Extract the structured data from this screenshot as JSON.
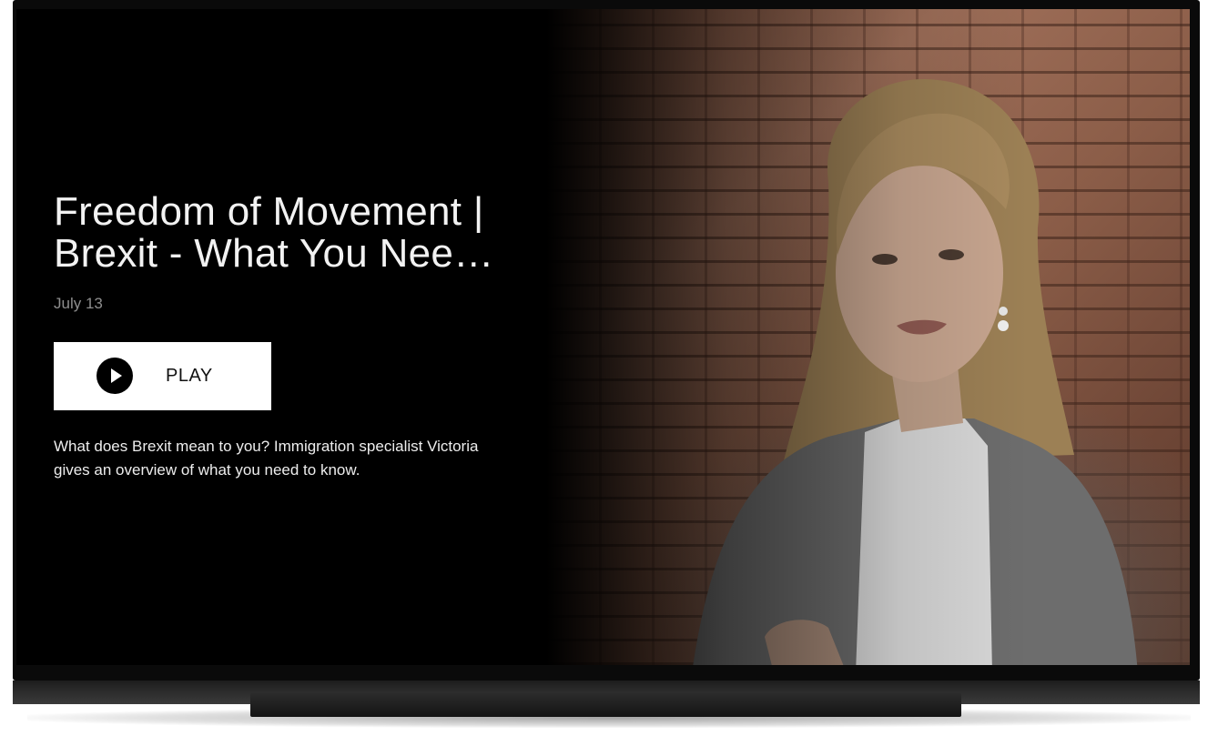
{
  "video": {
    "title": "Freedom of Movement | Brexit - What You Nee…",
    "date": "July 13",
    "description": "What does Brexit mean to you? Immigration specialist Victoria gives an overview of what you need to know.",
    "thumbnail_icon": "video-thumbnail-person"
  },
  "actions": {
    "play_label": "PLAY",
    "play_icon": "play-circle-icon"
  },
  "colors": {
    "background": "#000000",
    "title": "#f2f2f2",
    "date": "#8e8e8e",
    "button_background": "#ffffff",
    "button_text": "#111111"
  }
}
